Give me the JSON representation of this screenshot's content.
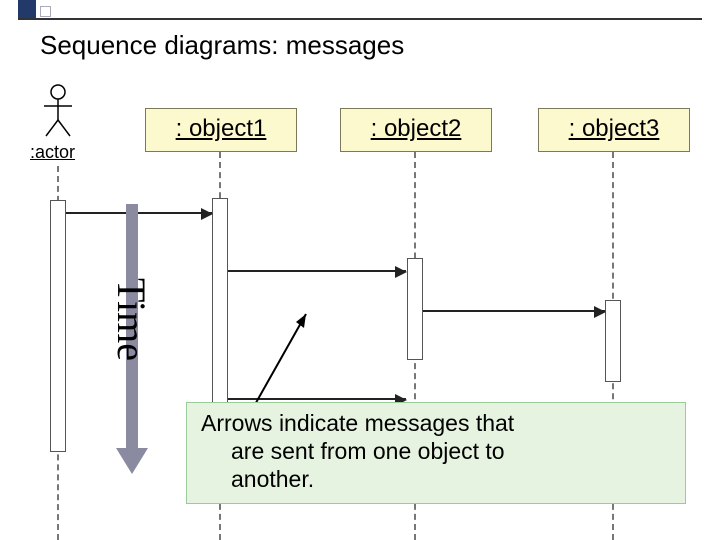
{
  "title": "Sequence diagrams: messages",
  "actor": {
    "label": ":actor"
  },
  "objects": {
    "o1": ": object1",
    "o2": ": object2",
    "o3": ": object3"
  },
  "time_label": "Time",
  "caption": {
    "line1": "Arrows indicate messages that",
    "line2": "are sent from one object to",
    "line3": "another."
  },
  "chart_data": {
    "type": "diagram",
    "diagram_kind": "uml-sequence",
    "title": "Sequence diagrams: messages",
    "participants": [
      {
        "id": "actor",
        "label": ":actor",
        "kind": "actor"
      },
      {
        "id": "object1",
        "label": ": object1",
        "kind": "object"
      },
      {
        "id": "object2",
        "label": ": object2",
        "kind": "object"
      },
      {
        "id": "object3",
        "label": ": object3",
        "kind": "object"
      }
    ],
    "messages": [
      {
        "from": "actor",
        "to": "object1",
        "order": 1
      },
      {
        "from": "object1",
        "to": "object2",
        "order": 2
      },
      {
        "from": "object2",
        "to": "object3",
        "order": 3
      },
      {
        "from": "object1",
        "to": "object2",
        "order": 4
      }
    ],
    "time_axis": "top-to-bottom",
    "annotation": "Arrows indicate messages that are sent from one object to another."
  }
}
